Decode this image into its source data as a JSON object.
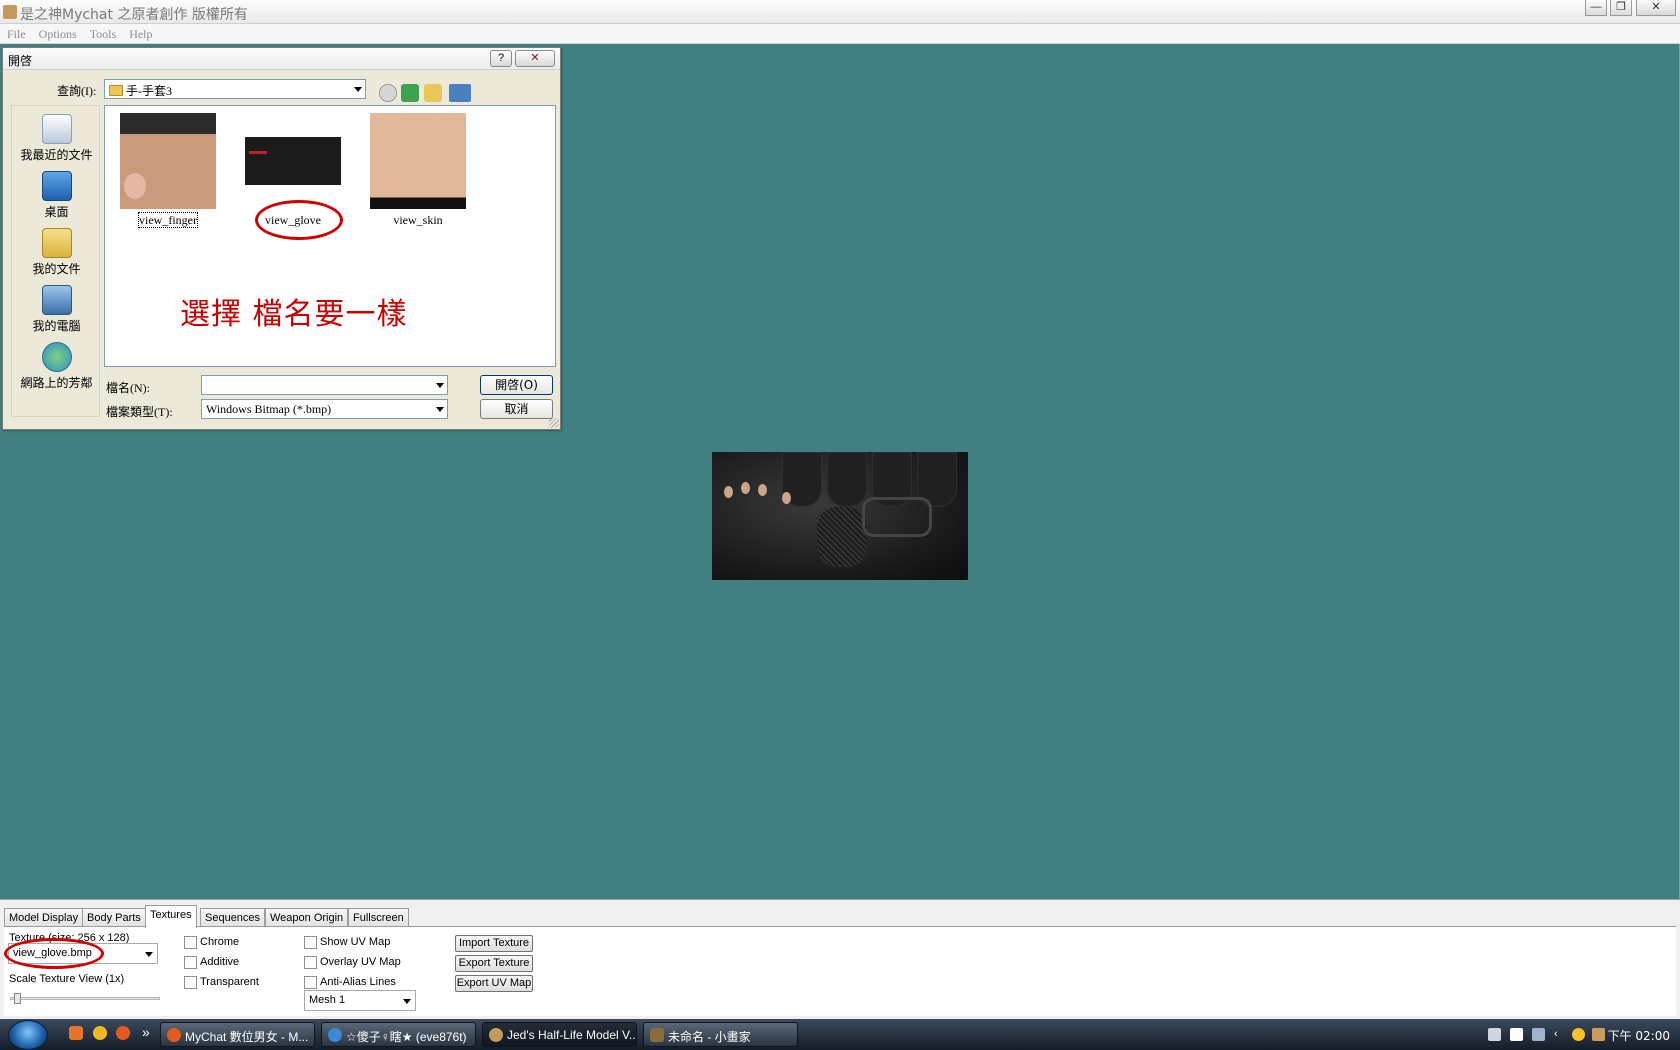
{
  "window": {
    "title": "是之神Mychat 之原者創作 版權所有",
    "buttons": {
      "minimize": "—",
      "restore": "❐",
      "close": "✕"
    }
  },
  "menu": [
    "File",
    "Options",
    "Tools",
    "Help"
  ],
  "dialog": {
    "title": "開啓",
    "help": "?",
    "close": "✕",
    "lookin_label": "查詢(I):",
    "lookin_value": "手-手套3",
    "places": [
      "我最近的文件",
      "桌面",
      "我的文件",
      "我的電腦",
      "網路上的芳鄰"
    ],
    "files": [
      "view_finger",
      "view_glove",
      "view_skin"
    ],
    "annotation": "選擇 檔名要一樣",
    "filename_label": "檔名(N):",
    "filename_value": "",
    "filetype_label": "檔案類型(T):",
    "filetype_value": "Windows Bitmap (*.bmp)",
    "open_button": "開啓(O)",
    "cancel_button": "取消",
    "colors": {
      "annotation": "#c80000",
      "viewport": "#408080"
    }
  },
  "panel": {
    "tabs": [
      "Model Display",
      "Body Parts",
      "Textures",
      "Sequences",
      "Weapon Origin",
      "Fullscreen"
    ],
    "active_tab": "Textures",
    "texture_label": "Texture (size: 256 x 128)",
    "texture_value": "view_glove.bmp",
    "scale_label": "Scale Texture View (1x)",
    "checkboxes_col1": [
      "Chrome",
      "Additive",
      "Transparent"
    ],
    "checkboxes_col2": [
      "Show UV Map",
      "Overlay UV Map",
      "Anti-Alias Lines"
    ],
    "mesh_value": "Mesh 1",
    "buttons": [
      "Import Texture",
      "Export Texture",
      "Export UV Map"
    ]
  },
  "taskbar": {
    "tasks": [
      "MyChat 數位男女 - M...",
      "☆傻子♀瞎★ (eve876t)",
      "Jed's Half-Life Model V...",
      "未命名 - 小畫家"
    ],
    "active_task": 2,
    "clock": "下午 02:00",
    "quicklaunch_more": "»"
  }
}
